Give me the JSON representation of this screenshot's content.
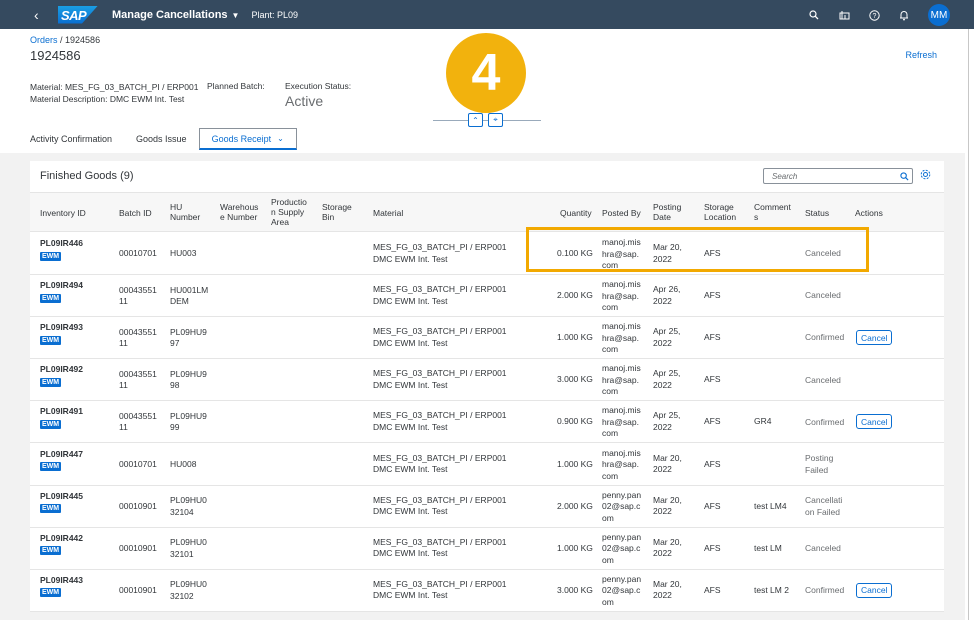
{
  "shell": {
    "app_title": "Manage Cancellations",
    "plant": "Plant: PL09",
    "logo": "SAP",
    "user_initials": "MM"
  },
  "header": {
    "breadcrumb_link": "Orders",
    "breadcrumb_sep": " / ",
    "breadcrumb_current": "1924586",
    "title": "1924586",
    "refresh": "Refresh",
    "material": "Material: MES_FG_03_BATCH_PI / ERP001",
    "material_description": "Material Description: DMC EWM Int. Test",
    "planned_batch_label": "Planned Batch:",
    "execution_status_label": "Execution Status:",
    "execution_status_value": "Active"
  },
  "tabs": [
    {
      "label": "Activity Confirmation"
    },
    {
      "label": "Goods Issue"
    },
    {
      "label": "Goods Receipt",
      "active": true
    }
  ],
  "step_badge": "4",
  "table": {
    "title": "Finished Goods (9)",
    "search_placeholder": "Search",
    "columns": [
      "Inventory ID",
      "Batch ID",
      "HU Number",
      "Warehouse Number",
      "Production Supply Area",
      "Storage Bin",
      "Material",
      "Quantity",
      "Posted By",
      "Posting Date",
      "Storage Location",
      "Comments",
      "Status",
      "Actions"
    ],
    "column_lines": {
      "hu": [
        "HU",
        "Number"
      ],
      "wh": [
        "Warehous",
        "e Number"
      ],
      "psa": [
        "Productio",
        "n Supply",
        "Area"
      ],
      "bin": [
        "Storage",
        "Bin"
      ],
      "pdate": [
        "Posting",
        "Date"
      ],
      "sloc": [
        "Storage",
        "Location"
      ],
      "comm": [
        "Comment",
        "s"
      ]
    },
    "ewm_label": "EWM",
    "cancel_label": "Cancel",
    "rows": [
      {
        "inv": "PL09IR446",
        "batch": [
          "00010701"
        ],
        "hu": [
          "HU003"
        ],
        "mat1": "MES_FG_03_BATCH_PI / ERP001",
        "mat2": "DMC EWM Int. Test",
        "qty": "0.100 KG",
        "by": [
          "manoj.mis",
          "hra@sap.",
          "com"
        ],
        "date": [
          "Mar 20,",
          "2022"
        ],
        "sloc": "AFS",
        "comment": "",
        "status": [
          "Canceled"
        ],
        "action": false
      },
      {
        "inv": "PL09IR494",
        "batch": [
          "00043551",
          "11"
        ],
        "hu": [
          "HU001LM",
          "DEM"
        ],
        "mat1": "MES_FG_03_BATCH_PI / ERP001",
        "mat2": "DMC EWM Int. Test",
        "qty": "2.000 KG",
        "by": [
          "manoj.mis",
          "hra@sap.",
          "com"
        ],
        "date": [
          "Apr 26,",
          "2022"
        ],
        "sloc": "AFS",
        "comment": "",
        "status": [
          "Canceled"
        ],
        "action": false
      },
      {
        "inv": "PL09IR493",
        "batch": [
          "00043551",
          "11"
        ],
        "hu": [
          "PL09HU9",
          "97"
        ],
        "mat1": "MES_FG_03_BATCH_PI / ERP001",
        "mat2": "DMC EWM Int. Test",
        "qty": "1.000 KG",
        "by": [
          "manoj.mis",
          "hra@sap.",
          "com"
        ],
        "date": [
          "Apr 25,",
          "2022"
        ],
        "sloc": "AFS",
        "comment": "",
        "status": [
          "Confirmed"
        ],
        "action": true
      },
      {
        "inv": "PL09IR492",
        "batch": [
          "00043551",
          "11"
        ],
        "hu": [
          "PL09HU9",
          "98"
        ],
        "mat1": "MES_FG_03_BATCH_PI / ERP001",
        "mat2": "DMC EWM Int. Test",
        "qty": "3.000 KG",
        "by": [
          "manoj.mis",
          "hra@sap.",
          "com"
        ],
        "date": [
          "Apr 25,",
          "2022"
        ],
        "sloc": "AFS",
        "comment": "",
        "status": [
          "Canceled"
        ],
        "action": false
      },
      {
        "inv": "PL09IR491",
        "batch": [
          "00043551",
          "11"
        ],
        "hu": [
          "PL09HU9",
          "99"
        ],
        "mat1": "MES_FG_03_BATCH_PI / ERP001",
        "mat2": "DMC EWM Int. Test",
        "qty": "0.900 KG",
        "by": [
          "manoj.mis",
          "hra@sap.",
          "com"
        ],
        "date": [
          "Apr 25,",
          "2022"
        ],
        "sloc": "AFS",
        "comment": "GR4",
        "status": [
          "Confirmed"
        ],
        "action": true
      },
      {
        "inv": "PL09IR447",
        "batch": [
          "00010701"
        ],
        "hu": [
          "HU008"
        ],
        "mat1": "MES_FG_03_BATCH_PI / ERP001",
        "mat2": "DMC EWM Int. Test",
        "qty": "1.000 KG",
        "by": [
          "manoj.mis",
          "hra@sap.",
          "com"
        ],
        "date": [
          "Mar 20,",
          "2022"
        ],
        "sloc": "AFS",
        "comment": "",
        "status": [
          "Posting",
          "Failed"
        ],
        "action": false
      },
      {
        "inv": "PL09IR445",
        "batch": [
          "00010901"
        ],
        "hu": [
          "PL09HU0",
          "32104"
        ],
        "mat1": "MES_FG_03_BATCH_PI / ERP001",
        "mat2": "DMC EWM Int. Test",
        "qty": "2.000 KG",
        "by": [
          "penny.pan",
          "02@sap.c",
          "om"
        ],
        "date": [
          "Mar 20,",
          "2022"
        ],
        "sloc": "AFS",
        "comment": "test LM4",
        "status": [
          "Cancellati",
          "on Failed"
        ],
        "action": false
      },
      {
        "inv": "PL09IR442",
        "batch": [
          "00010901"
        ],
        "hu": [
          "PL09HU0",
          "32101"
        ],
        "mat1": "MES_FG_03_BATCH_PI / ERP001",
        "mat2": "DMC EWM Int. Test",
        "qty": "1.000 KG",
        "by": [
          "penny.pan",
          "02@sap.c",
          "om"
        ],
        "date": [
          "Mar 20,",
          "2022"
        ],
        "sloc": "AFS",
        "comment": "test LM",
        "status": [
          "Canceled"
        ],
        "action": false
      },
      {
        "inv": "PL09IR443",
        "batch": [
          "00010901"
        ],
        "hu": [
          "PL09HU0",
          "32102"
        ],
        "mat1": "MES_FG_03_BATCH_PI / ERP001",
        "mat2": "DMC EWM Int. Test",
        "qty": "3.000 KG",
        "by": [
          "penny.pan",
          "02@sap.c",
          "om"
        ],
        "date": [
          "Mar 20,",
          "2022"
        ],
        "sloc": "AFS",
        "comment": "test LM 2",
        "status": [
          "Confirmed"
        ],
        "action": true
      }
    ]
  }
}
